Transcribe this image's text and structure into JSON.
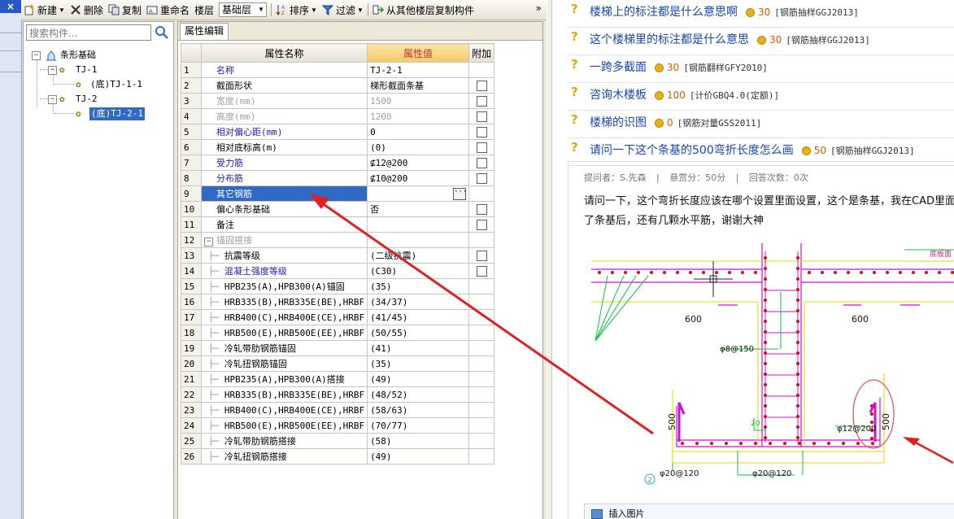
{
  "left_strip": {
    "close_glyph": "×"
  },
  "toolbar": {
    "new_label": "新建",
    "delete_label": "删除",
    "copy_label": "复制",
    "rename_label": "重命名",
    "floor_label": "楼层",
    "floor_value": "基础层",
    "sort_label": "排序",
    "filter_label": "过滤",
    "copy_from_floor_label": "从其他楼层复制构件",
    "more_glyph": "»"
  },
  "tree": {
    "search_placeholder": "搜索构件...",
    "root_label": "条形基础",
    "items": [
      {
        "label": "TJ-1",
        "children": [
          "(底)TJ-1-1"
        ]
      },
      {
        "label": "TJ-2",
        "children": [
          "(底)TJ-2-1"
        ]
      }
    ]
  },
  "props": {
    "tab_label": "属性编辑",
    "header": {
      "name": "属性名称",
      "value": "属性值",
      "add": "附加"
    },
    "rows": [
      {
        "n": "1",
        "name": "名称",
        "value": "TJ-2-1",
        "style": "blue",
        "check": false
      },
      {
        "n": "2",
        "name": "截面形状",
        "value": "梯形截面条基",
        "style": "",
        "check": true
      },
      {
        "n": "3",
        "name": "宽度(mm)",
        "value": "1500",
        "style": "grey",
        "check": true
      },
      {
        "n": "4",
        "name": "高度(mm)",
        "value": "1200",
        "style": "grey",
        "check": true
      },
      {
        "n": "5",
        "name": "相对偏心距(mm)",
        "value": "0",
        "style": "blue",
        "check": true
      },
      {
        "n": "6",
        "name": "相对底标高(m)",
        "value": "(0)",
        "style": "",
        "check": true
      },
      {
        "n": "7",
        "name": "受力筋",
        "value": "⊈12@200",
        "style": "blue",
        "check": true
      },
      {
        "n": "8",
        "name": "分布筋",
        "value": "⊈10@200",
        "style": "blue",
        "check": true
      },
      {
        "n": "9",
        "name": "其它钢筋",
        "value": "",
        "style": "sel",
        "check": false
      },
      {
        "n": "10",
        "name": "偏心条形基础",
        "value": "否",
        "style": "",
        "check": true
      },
      {
        "n": "11",
        "name": "备注",
        "value": "",
        "style": "",
        "check": true
      },
      {
        "n": "12",
        "name": "锚固搭接",
        "value": "",
        "style": "group",
        "check": false
      },
      {
        "n": "13",
        "name": "抗震等级",
        "value": "(二级抗震)",
        "style": "sub",
        "check": true
      },
      {
        "n": "14",
        "name": "混凝土强度等级",
        "value": "(C30)",
        "style": "subblue",
        "check": true
      },
      {
        "n": "15",
        "name": "HPB235(A),HPB300(A)锚固",
        "value": "(35)",
        "style": "sub",
        "check": false
      },
      {
        "n": "16",
        "name": "HRB335(B),HRB335E(BE),HRBF",
        "value": "(34/37)",
        "style": "sub",
        "check": false
      },
      {
        "n": "17",
        "name": "HRB400(C),HRB400E(CE),HRBF",
        "value": "(41/45)",
        "style": "sub",
        "check": false
      },
      {
        "n": "18",
        "name": "HRB500(E),HRB500E(EE),HRBF",
        "value": "(50/55)",
        "style": "sub",
        "check": false
      },
      {
        "n": "19",
        "name": "冷轧带肋钢筋锚固",
        "value": "(41)",
        "style": "sub",
        "check": false
      },
      {
        "n": "20",
        "name": "冷轧扭钢筋锚固",
        "value": "(35)",
        "style": "sub",
        "check": false
      },
      {
        "n": "21",
        "name": "HPB235(A),HPB300(A)搭接",
        "value": "(49)",
        "style": "sub",
        "check": false
      },
      {
        "n": "22",
        "name": "HRB335(B),HRB335E(BE),HRBF",
        "value": "(48/52)",
        "style": "sub",
        "check": false
      },
      {
        "n": "23",
        "name": "HRB400(C),HRB400E(CE),HRBF",
        "value": "(58/63)",
        "style": "sub",
        "check": false
      },
      {
        "n": "24",
        "name": "HRB500(E),HRB500E(EE),HRBF",
        "value": "(70/77)",
        "style": "sub",
        "check": false
      },
      {
        "n": "25",
        "name": "冷轧带肋钢筋搭接",
        "value": "(58)",
        "style": "sub",
        "check": false
      },
      {
        "n": "26",
        "name": "冷轧扭钢筋搭接",
        "value": "(49)",
        "style": "sub",
        "check": false
      }
    ]
  },
  "qa": {
    "list": [
      {
        "title": "楼梯上的标注都是什么意思啊",
        "points": "30",
        "tag": "[钢筋抽样GGJ2013]"
      },
      {
        "title": "这个楼梯里的标注都是什么意思",
        "points": "30",
        "tag": "[钢筋抽样GGJ2013]"
      },
      {
        "title": "一跨多截面",
        "points": "30",
        "tag": "[钢筋翻样GFY2010]"
      },
      {
        "title": "咨询木楼板",
        "points": "100",
        "tag": "[计价GBQ4.0(定额)]"
      },
      {
        "title": "楼梯的识图",
        "points": "0",
        "tag": "[钢筋对量GSS2011]"
      },
      {
        "title": "请问一下这个条基的500弯折长度怎么画",
        "points": "50",
        "tag": "[钢筋抽样GGJ2013]"
      }
    ],
    "question_mark": "?",
    "meta": {
      "asker": "提问者：S.先森",
      "sep1": "|",
      "bounty": "悬赏分：50分",
      "sep2": "|",
      "answers": "回答次数：0次"
    },
    "body": "请问一下，这个弯折长度应该在哪个设置里面设置，这个是条基，我在CAD里面画了条基后，还有几颗水平筋，谢谢大神",
    "insert_image_label": "插入图片",
    "drawing": {
      "label_600_left": "600",
      "label_600_right": "600",
      "label_500_left": "500",
      "label_500_right": "500",
      "label_rebar_150": "φ8@150",
      "label_rebar_12": "φ12@200",
      "label_20_left": "φ20@120",
      "label_20_right": "φ20@120",
      "label_bottom_mark": "底板面",
      "label_20_small": "20",
      "label_circle_2": "2"
    }
  },
  "colors": {
    "selection": "#316ac5",
    "link_blue": "#1a45b7",
    "annotation_red": "#e02020",
    "cad_magenta": "#d010d0",
    "cad_green": "#10c040",
    "cad_yellow": "#e4d800"
  }
}
